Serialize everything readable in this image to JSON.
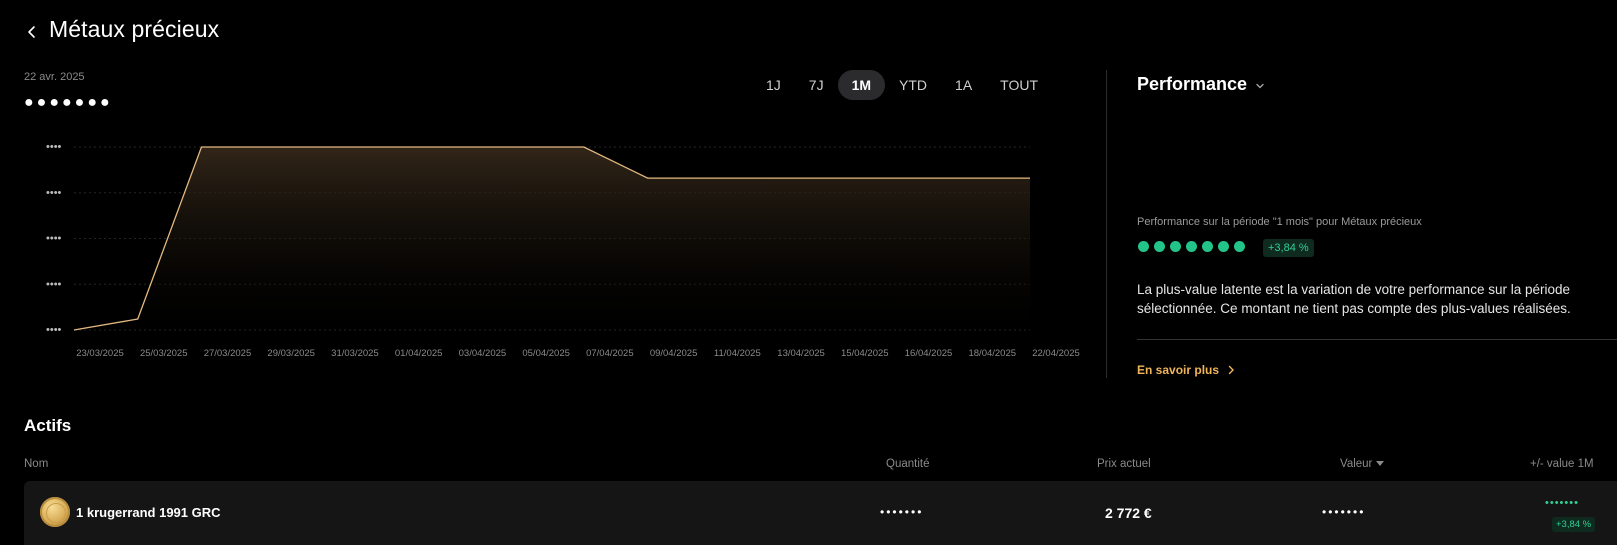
{
  "header": {
    "title": "Métaux précieux",
    "date": "22 avr. 2025",
    "masked_value": "●●●●●●●"
  },
  "period_tabs": [
    {
      "label": "1J",
      "active": false
    },
    {
      "label": "7J",
      "active": false
    },
    {
      "label": "1M",
      "active": true
    },
    {
      "label": "YTD",
      "active": false
    },
    {
      "label": "1A",
      "active": false
    },
    {
      "label": "TOUT",
      "active": false
    }
  ],
  "chart_data": {
    "type": "area",
    "x": [
      "23/03/2025",
      "25/03/2025",
      "27/03/2025",
      "29/03/2025",
      "31/03/2025",
      "01/04/2025",
      "03/04/2025",
      "05/04/2025",
      "07/04/2025",
      "09/04/2025",
      "11/04/2025",
      "13/04/2025",
      "15/04/2025",
      "16/04/2025",
      "18/04/2025",
      "22/04/2025"
    ],
    "y_tick_labels": [
      "••••",
      "••••",
      "••••",
      "••••",
      "••••"
    ],
    "series": [
      {
        "values": [
          0.0,
          0.06,
          1.0,
          1.0,
          1.0,
          1.0,
          1.0,
          1.0,
          1.0,
          0.83,
          0.83,
          0.83,
          0.83,
          0.83,
          0.83,
          0.83
        ]
      }
    ],
    "line_color": "#e3b980",
    "grid": true
  },
  "performance": {
    "title": "Performance",
    "caption": "Performance sur la période \"1 mois\" pour Métaux précieux",
    "badge": "+3,84 %",
    "description": "La plus-value latente est la variation de votre performance sur la période sélectionnée. Ce montant ne tient pas compte des plus-values réalisées.",
    "learn_more": "En savoir plus"
  },
  "assets": {
    "title": "Actifs",
    "columns": {
      "name": "Nom",
      "quantity": "Quantité",
      "price": "Prix actuel",
      "value": "Valeur",
      "perf": "+/- value 1M"
    },
    "rows": [
      {
        "name": "1 krugerrand 1991 GRC",
        "quantity": "•••••••",
        "price": "2 772 €",
        "value": "•••••••",
        "perf_masked": "•••••••",
        "perf_badge": "+3,84 %"
      }
    ]
  },
  "colors": {
    "accent": "#e3b980",
    "positive": "#2fd194",
    "link": "#f0b45a",
    "background": "#000000"
  }
}
